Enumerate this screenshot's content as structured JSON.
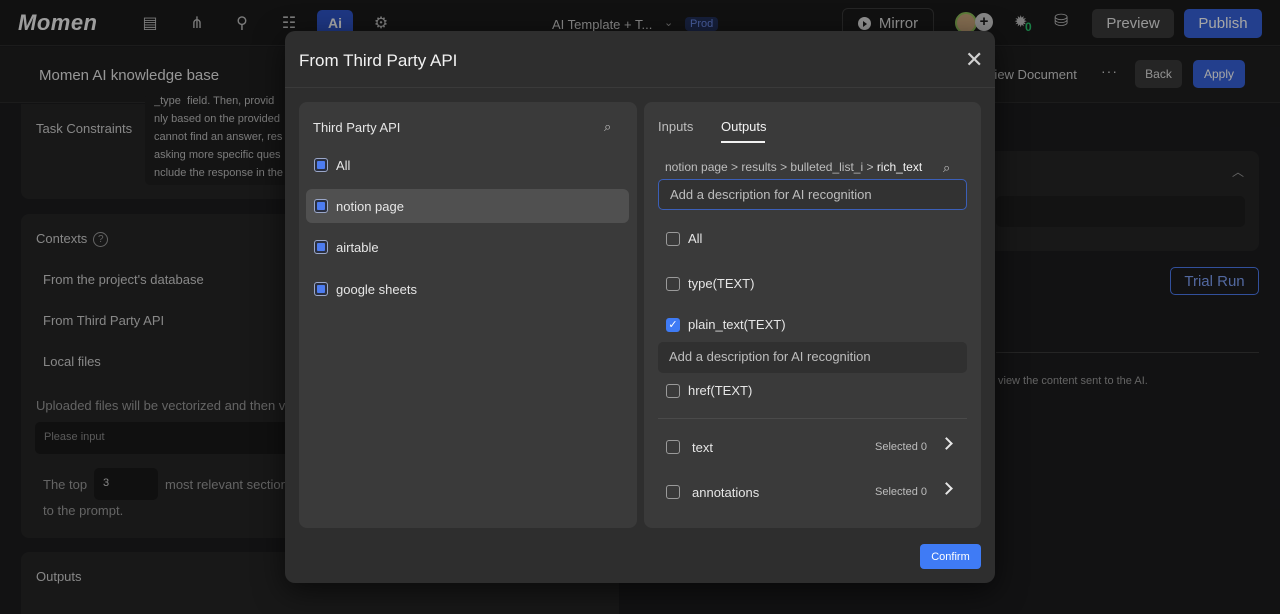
{
  "topbar": {
    "logo": "Momen",
    "nav_icons": [
      {
        "icon": "layout-icon",
        "glyph": "▤"
      },
      {
        "icon": "flow-icon",
        "glyph": "⌘"
      },
      {
        "icon": "plug-icon",
        "glyph": "✎"
      },
      {
        "icon": "data-icon",
        "glyph": "☷"
      },
      {
        "icon": "ai-icon",
        "glyph": "Ai",
        "active": true
      },
      {
        "icon": "gear-icon",
        "glyph": "⚙"
      }
    ],
    "project_title": "AI Template + T...",
    "env_badge": "Prod",
    "mirror_label": "Mirror",
    "bug_count": "0",
    "preview_label": "Preview",
    "publish_label": "Publish"
  },
  "subheader": {
    "title": "Momen AI knowledge base",
    "view_document": "View Document",
    "more": "···",
    "back_label": "Back",
    "apply_label": "Apply"
  },
  "background": {
    "task_constraints_label": "Task Constraints",
    "task_constraints_text": "_type  field. Then, provid\nnly based on the provided\ncannot find an answer, res\nasking more specific ques\nnclude the response in the",
    "contexts_label": "Contexts",
    "context_sources": [
      "From the project's database",
      "From Third Party API",
      "Local files"
    ],
    "uploaded_note": "Uploaded files will be vectorized and then v",
    "input_placeholder": "Please input",
    "top_prefix": "The top",
    "top_value": "3",
    "top_suffix": "most relevant section",
    "top_suffix2": "to the prompt.",
    "outputs_label": "Outputs",
    "trial_run_label": "Trial Run",
    "right_note": "view the content sent to the AI."
  },
  "modal": {
    "title": "From Third Party API",
    "left_pane": {
      "heading": "Third Party API",
      "items": [
        {
          "label": "All",
          "state": "part",
          "selected": false
        },
        {
          "label": "notion page",
          "state": "part",
          "selected": true
        },
        {
          "label": "airtable",
          "state": "part",
          "selected": false
        },
        {
          "label": "google sheets",
          "state": "part",
          "selected": false
        }
      ]
    },
    "right_pane": {
      "tabs": [
        "Inputs",
        "Outputs"
      ],
      "active_tab": "Outputs",
      "path_prefix": "notion page > results > bulleted_list_i > ",
      "path_current": "rich_text",
      "description_placeholder": "Add a description for AI recognition",
      "fields": [
        {
          "label": "All",
          "checked": false
        },
        {
          "label": "type(TEXT)",
          "checked": false
        },
        {
          "label": "plain_text(TEXT)",
          "checked": true
        },
        {
          "label": "href(TEXT)",
          "checked": false
        }
      ],
      "groups": [
        {
          "label": "text",
          "selected": "Selected 0"
        },
        {
          "label": "annotations",
          "selected": "Selected 0"
        }
      ]
    },
    "confirm_label": "Confirm"
  }
}
